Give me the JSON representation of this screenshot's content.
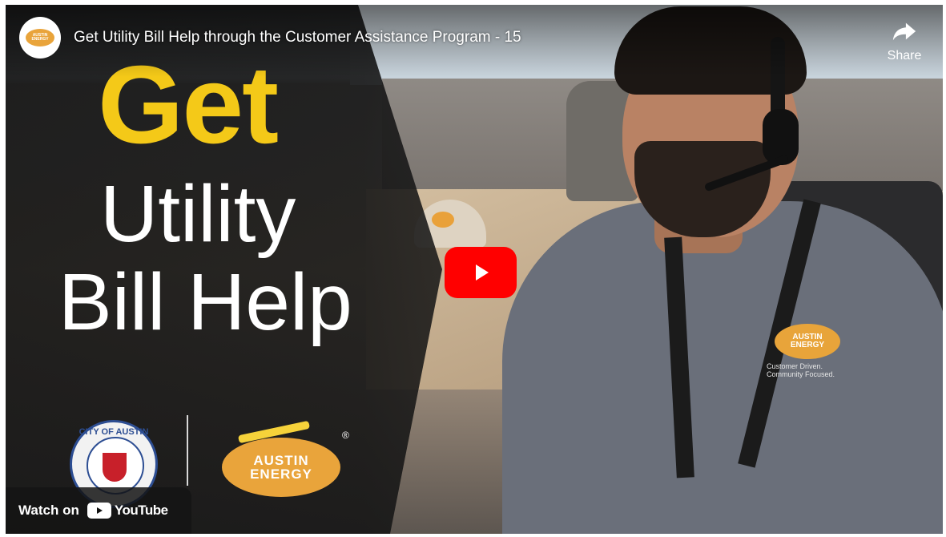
{
  "video": {
    "title": "Get Utility Bill Help through the Customer Assistance Program - 15",
    "share_label": "Share",
    "watch_on_label": "Watch on",
    "youtube_label": "YouTube"
  },
  "channel": {
    "logo_text": "AUSTIN ENERGY"
  },
  "thumbnail": {
    "headline_line1": "Get",
    "headline_line2": "Utility",
    "headline_line3": "Bill Help",
    "seal_text": "CITY OF AUSTIN",
    "logo_line1": "AUSTIN",
    "logo_line2": "ENERGY",
    "registered_mark": "®",
    "shirt_logo_line1": "AUSTIN",
    "shirt_logo_line2": "ENERGY",
    "shirt_tagline": "Customer Driven. Community Focused."
  },
  "colors": {
    "headline_yellow": "#f4c918",
    "play_red": "#ff0000",
    "brand_orange": "#e9a43b",
    "seal_blue": "#2d4e93"
  },
  "icons": {
    "share": "share-arrow-icon",
    "play": "play-icon",
    "youtube": "youtube-icon"
  }
}
